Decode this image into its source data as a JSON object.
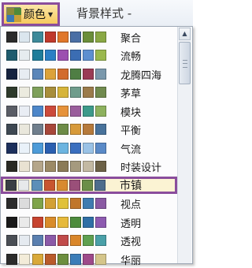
{
  "ribbon": {
    "colors_label": "颜色",
    "colors_chevron": "▼",
    "background_style_label": "背景样式 -"
  },
  "menu": {
    "selected_index": 8,
    "themes": [
      {
        "name": "聚合",
        "swatches": [
          "#2b2b2b",
          "#dbe6ee",
          "#3d8a9a",
          "#c0392b",
          "#e0772a",
          "#4a6fa5",
          "#6b8e3a",
          "#8aa844"
        ]
      },
      {
        "name": "流畅",
        "swatches": [
          "#1e5c6e",
          "#e6ecef",
          "#1f7d9a",
          "#2b7fc5",
          "#9c4fb0",
          "#3b6db3",
          "#5d8fd0",
          "#9ab84d"
        ]
      },
      {
        "name": "龙腾四海",
        "swatches": [
          "#16233f",
          "#e7ecf2",
          "#5b86b9",
          "#dca23a",
          "#d26b2d",
          "#4f7e44",
          "#9a3c55",
          "#7a98ac"
        ]
      },
      {
        "name": "茅草",
        "swatches": [
          "#2e3a2c",
          "#ecebdf",
          "#7ea05b",
          "#a88e3a",
          "#d6b43a",
          "#6f9d8c",
          "#9b7b4b",
          "#708a4e"
        ]
      },
      {
        "name": "模块",
        "swatches": [
          "#5a5d66",
          "#e9edf4",
          "#4d86c9",
          "#cc4a3b",
          "#e6923a",
          "#9a5e9c",
          "#3d9a8a",
          "#8db15e"
        ]
      },
      {
        "name": "平衡",
        "swatches": [
          "#3d4752",
          "#e9e7dc",
          "#6f7e8d",
          "#a7473a",
          "#6d8b47",
          "#d79a3a",
          "#b67a3b",
          "#48729b"
        ]
      },
      {
        "name": "气流",
        "swatches": [
          "#1c2f5c",
          "#e9f1f9",
          "#4d9bd8",
          "#2a5fb0",
          "#6cb4e0",
          "#3a6fbf",
          "#9ac2e6",
          "#5a8ac7"
        ]
      },
      {
        "name": "时装设计",
        "swatches": [
          "#2a2a24",
          "#e9e2d2",
          "#b5a68a",
          "#9c8a66",
          "#8b7b58",
          "#a59a7e",
          "#c3b9a3",
          "#6c6146"
        ]
      },
      {
        "name": "市镇",
        "swatches": [
          "#3a3f44",
          "#e7e9eb",
          "#5c8fb8",
          "#c8552f",
          "#d88a2f",
          "#9a4f79",
          "#6b8e48",
          "#4e6d8c"
        ]
      },
      {
        "name": "视点",
        "swatches": [
          "#2b2b2b",
          "#dcdcdc",
          "#7fa44a",
          "#d3a135",
          "#e0c13a",
          "#c0762b",
          "#3f7cb0",
          "#8a5aa3"
        ]
      },
      {
        "name": "透明",
        "swatches": [
          "#1a1a1a",
          "#eaeaea",
          "#c7432f",
          "#d98c2a",
          "#e6b93a",
          "#4e8c3d",
          "#2f6fa5",
          "#8d5ab0"
        ]
      },
      {
        "name": "透视",
        "swatches": [
          "#4a4e55",
          "#e5eaf0",
          "#5a7fb0",
          "#8b5aa8",
          "#c04a4a",
          "#d9862a",
          "#5fa050",
          "#4aa0a8"
        ]
      },
      {
        "name": "华丽",
        "swatches": [
          "#2b2b2b",
          "#f3ecd9",
          "#d9a93a",
          "#b95b2b",
          "#6c8e3e",
          "#3b7db8",
          "#9e4a8a",
          "#d4c58a"
        ]
      }
    ]
  }
}
